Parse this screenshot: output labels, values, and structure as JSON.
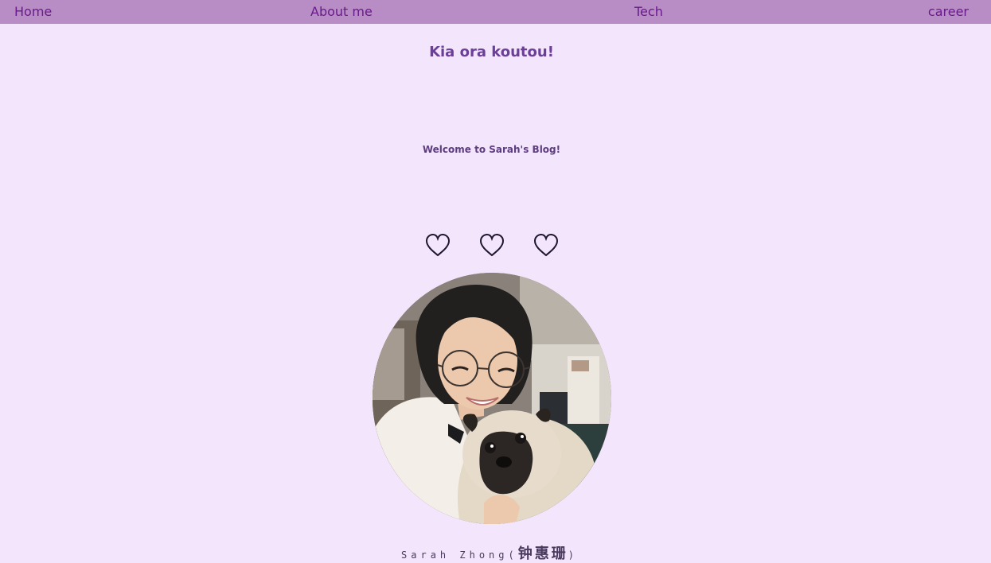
{
  "nav": {
    "home": "Home",
    "about": "About me",
    "tech": "Tech",
    "career": "career"
  },
  "hero": {
    "greeting": "Kia ora koutou!",
    "welcome": "Welcome to Sarah's Blog!"
  },
  "hearts": [
    {
      "icon": "heart-outline-icon"
    },
    {
      "icon": "heart-outline-icon"
    },
    {
      "icon": "heart-outline-icon"
    }
  ],
  "profile": {
    "name_latin": "Sarah Zhong(",
    "name_cjk": "钟惠珊",
    "name_close": ")"
  },
  "colors": {
    "navbar": "#b88dc6",
    "background": "#f3e5fc",
    "nav_text": "#6a1a8c",
    "heading": "#6b3f98"
  }
}
